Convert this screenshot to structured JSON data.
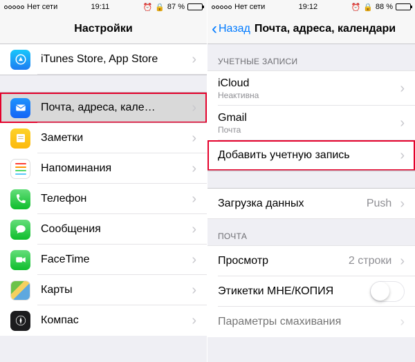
{
  "left": {
    "statusbar": {
      "carrier": "Нет сети",
      "time": "19:11",
      "battery_pct": "87 %"
    },
    "nav_title": "Настройки",
    "rows": {
      "appstore": "iTunes Store, App Store",
      "mail": "Почта, адреса, кале…",
      "notes": "Заметки",
      "reminders": "Напоминания",
      "phone": "Телефон",
      "messages": "Сообщения",
      "facetime": "FaceTime",
      "maps": "Карты",
      "compass": "Компас"
    }
  },
  "right": {
    "statusbar": {
      "carrier": "Нет сети",
      "time": "19:12",
      "battery_pct": "88 %"
    },
    "back_label": "Назад",
    "nav_title": "Почта, адреса, календари",
    "sections": {
      "accounts_header": "УЧЕТНЫЕ ЗАПИСИ",
      "mail_header": "ПОЧТА"
    },
    "accounts": {
      "icloud": {
        "title": "iCloud",
        "sub": "Неактивна"
      },
      "gmail": {
        "title": "Gmail",
        "sub": "Почта"
      },
      "add": "Добавить учетную запись"
    },
    "fetch": {
      "label": "Загрузка данных",
      "value": "Push"
    },
    "mail_settings": {
      "preview": {
        "label": "Просмотр",
        "value": "2 строки"
      },
      "labels": "Этикетки МНЕ/КОПИЯ",
      "swipe": "Параметры смахивания"
    }
  }
}
